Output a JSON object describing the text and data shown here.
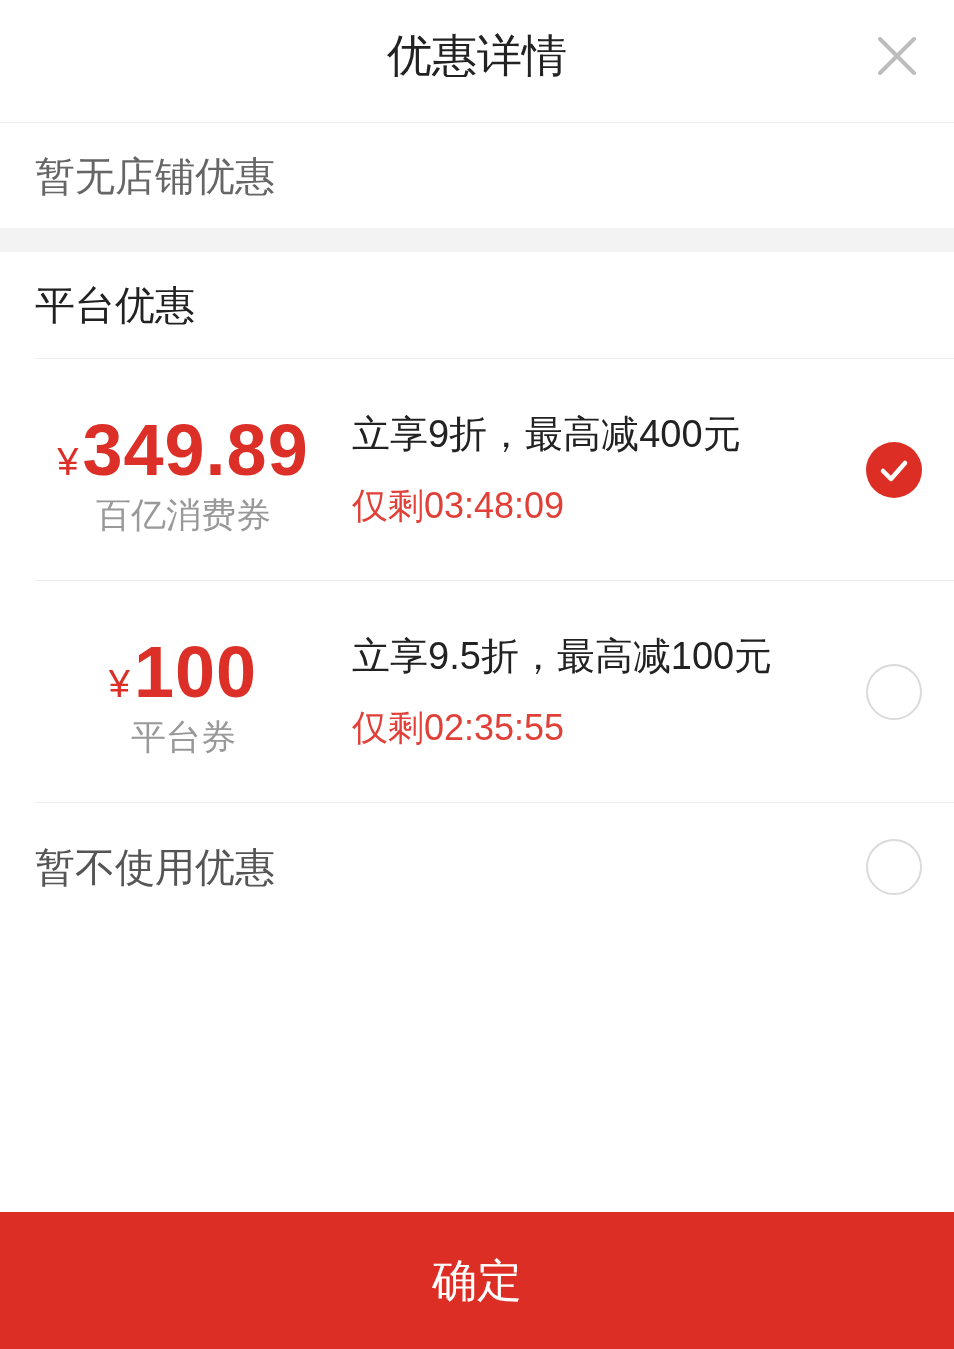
{
  "header": {
    "title": "优惠详情"
  },
  "shop_section": {
    "empty_text": "暂无店铺优惠"
  },
  "platform_section": {
    "title": "平台优惠",
    "options": [
      {
        "kind": "coupon",
        "currency": "¥",
        "amount": "349.89",
        "name": "百亿消费券",
        "description": "立享9折，最高减400元",
        "countdown": "仅剩03:48:09",
        "selected": true
      },
      {
        "kind": "coupon",
        "currency": "¥",
        "amount": "100",
        "name": "平台券",
        "description": "立享9.5折，最高减100元",
        "countdown": "仅剩02:35:55",
        "selected": false
      },
      {
        "kind": "none",
        "label": "暂不使用优惠",
        "selected": false
      }
    ]
  },
  "confirm_button": {
    "label": "确定"
  }
}
